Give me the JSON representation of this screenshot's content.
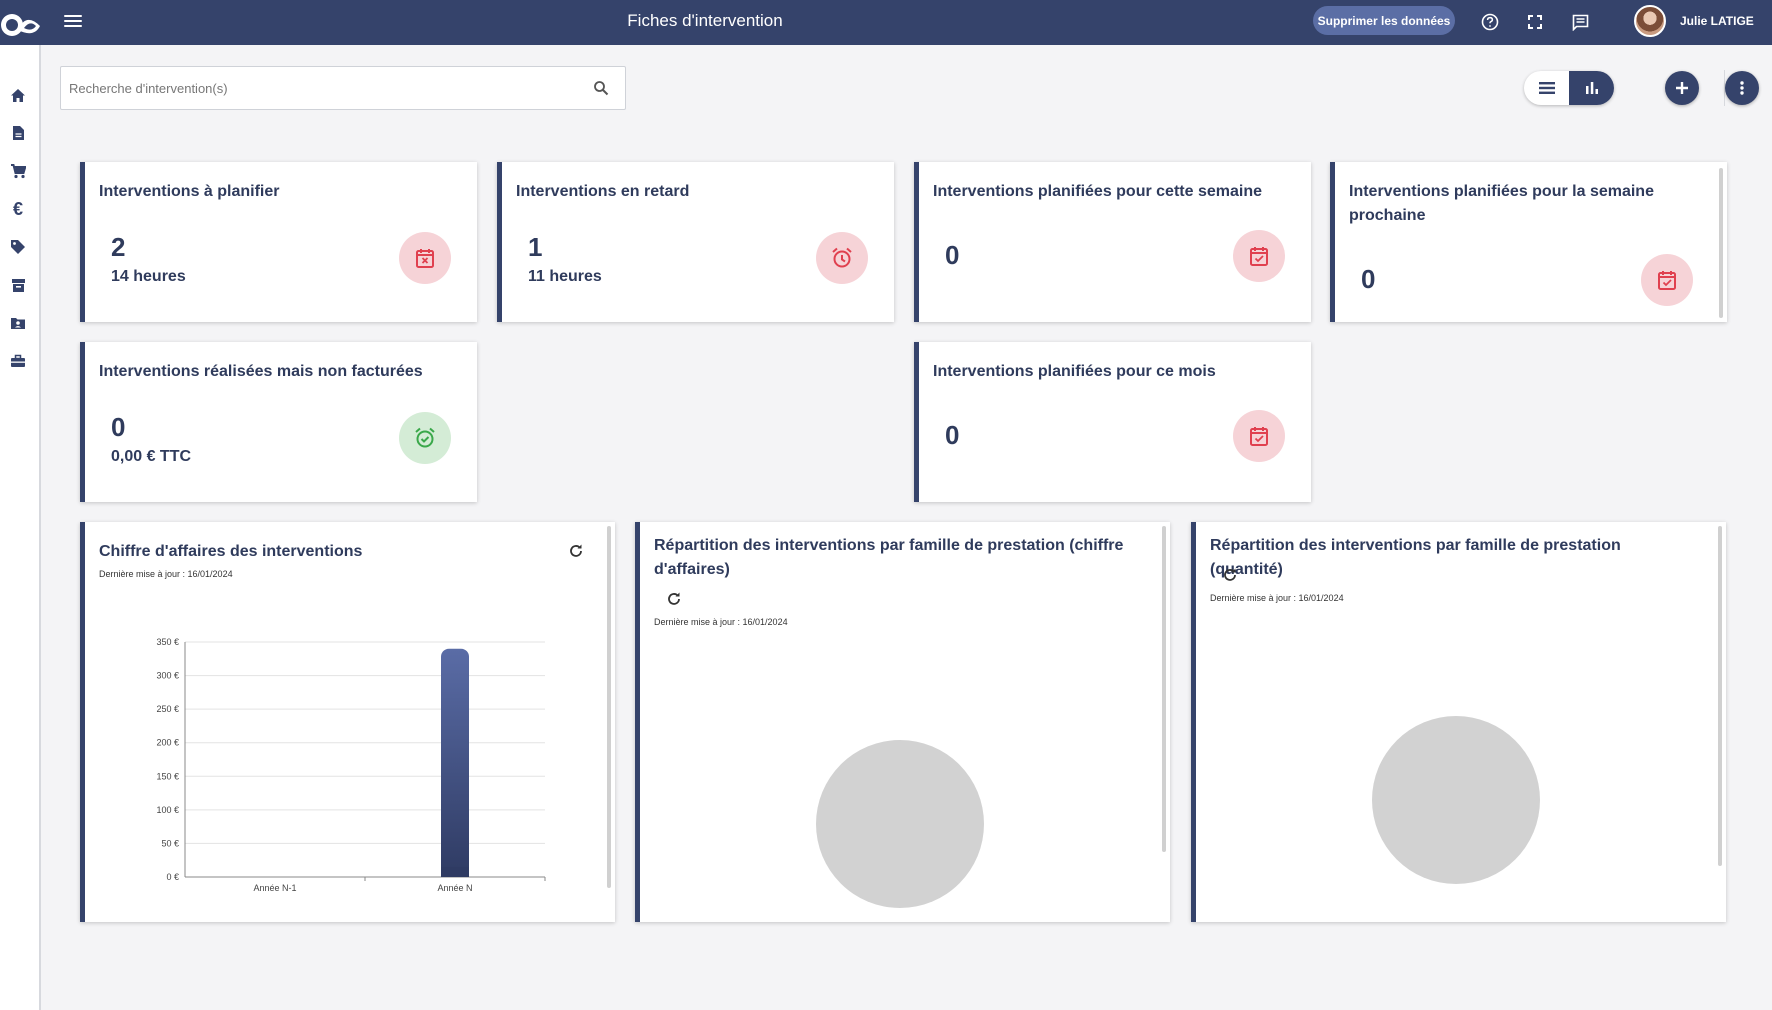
{
  "header": {
    "title": "Fiches d'intervention",
    "delete_button": "Supprimer les données",
    "user_name": "Julie LATIGE"
  },
  "search": {
    "placeholder": "Recherche d'intervention(s)"
  },
  "sidebar": {
    "items": [
      "home-icon",
      "document-icon",
      "cart-icon",
      "euro-icon",
      "tag-icon",
      "archive-icon",
      "contact-card-icon",
      "toolbox-icon"
    ]
  },
  "kpis": {
    "to_plan": {
      "title": "Interventions à planifier",
      "value": "2",
      "sub": "14 heures"
    },
    "late": {
      "title": "Interventions en retard",
      "value": "1",
      "sub": "11 heures"
    },
    "this_week": {
      "title": "Interventions planifiées pour cette semaine",
      "value": "0"
    },
    "next_week": {
      "title": "Interventions planifiées pour la semaine prochaine",
      "value": "0"
    },
    "done_not_billed": {
      "title": "Interventions réalisées mais non facturées",
      "value": "0",
      "sub": "0,00 € TTC"
    },
    "this_month": {
      "title": "Interventions planifiées pour ce mois",
      "value": "0"
    }
  },
  "charts": {
    "revenue": {
      "title": "Chiffre d'affaires des interventions",
      "updated": "Dernière mise à jour : 16/01/2024"
    },
    "by_family_revenue": {
      "title": "Répartition des interventions par famille de prestation (chiffre d'affaires)",
      "updated": "Dernière mise à jour : 16/01/2024"
    },
    "by_family_quantity": {
      "title": "Répartition des interventions par famille de prestation (quantité)",
      "updated": "Dernière mise à jour : 16/01/2024"
    }
  },
  "colors": {
    "primary": "#35436b",
    "danger_bg": "#f6d3d7",
    "danger": "#e0404f",
    "success_bg": "#d4ecd6",
    "success": "#3aa84a"
  },
  "chart_data": {
    "type": "bar",
    "categories": [
      "Année N-1",
      "Année N"
    ],
    "values": [
      0,
      340
    ],
    "yticks": [
      "0 €",
      "50 €",
      "100 €",
      "150 €",
      "200 €",
      "250 €",
      "300 €",
      "350 €"
    ],
    "ylim": [
      0,
      350
    ],
    "grid": true
  }
}
